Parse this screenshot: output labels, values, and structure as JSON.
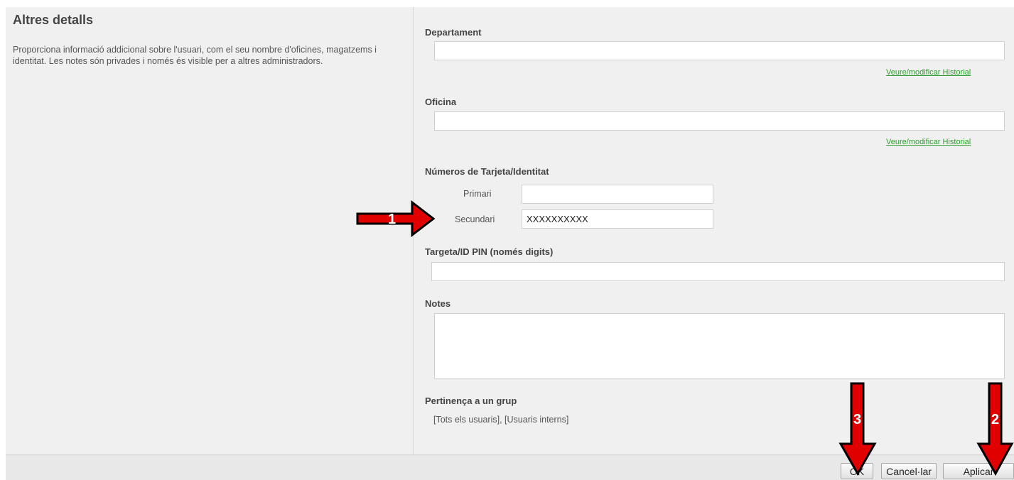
{
  "section": {
    "title": "Altres detalls",
    "description": "Proporciona informació addicional sobre l'usuari, com el seu nombre d'oficines, magatzems i identitat. Les notes són privades i només és visible per a altres administradors."
  },
  "fields": {
    "department": {
      "label": "Departament",
      "value": "",
      "history_link": "Veure/modificar Historial"
    },
    "office": {
      "label": "Oficina",
      "value": "",
      "history_link": "Veure/modificar Historial"
    },
    "card_numbers": {
      "label": "Números de Tarjeta/Identitat",
      "primary_label": "Primari",
      "primary_value": "",
      "secondary_label": "Secundari",
      "secondary_value": "XXXXXXXXXX"
    },
    "pin": {
      "label": "Targeta/ID PIN (només digits)",
      "value": ""
    },
    "notes": {
      "label": "Notes",
      "value": ""
    },
    "group": {
      "label": "Pertinença a un grup",
      "value": "[Tots els usuaris], [Usuaris interns]"
    }
  },
  "buttons": {
    "ok": "OK",
    "cancel": "Cancel·lar",
    "apply": "Aplicar"
  },
  "annotations": {
    "arrow_1": "1",
    "arrow_2": "2",
    "arrow_3": "3",
    "color": "#e00000"
  }
}
